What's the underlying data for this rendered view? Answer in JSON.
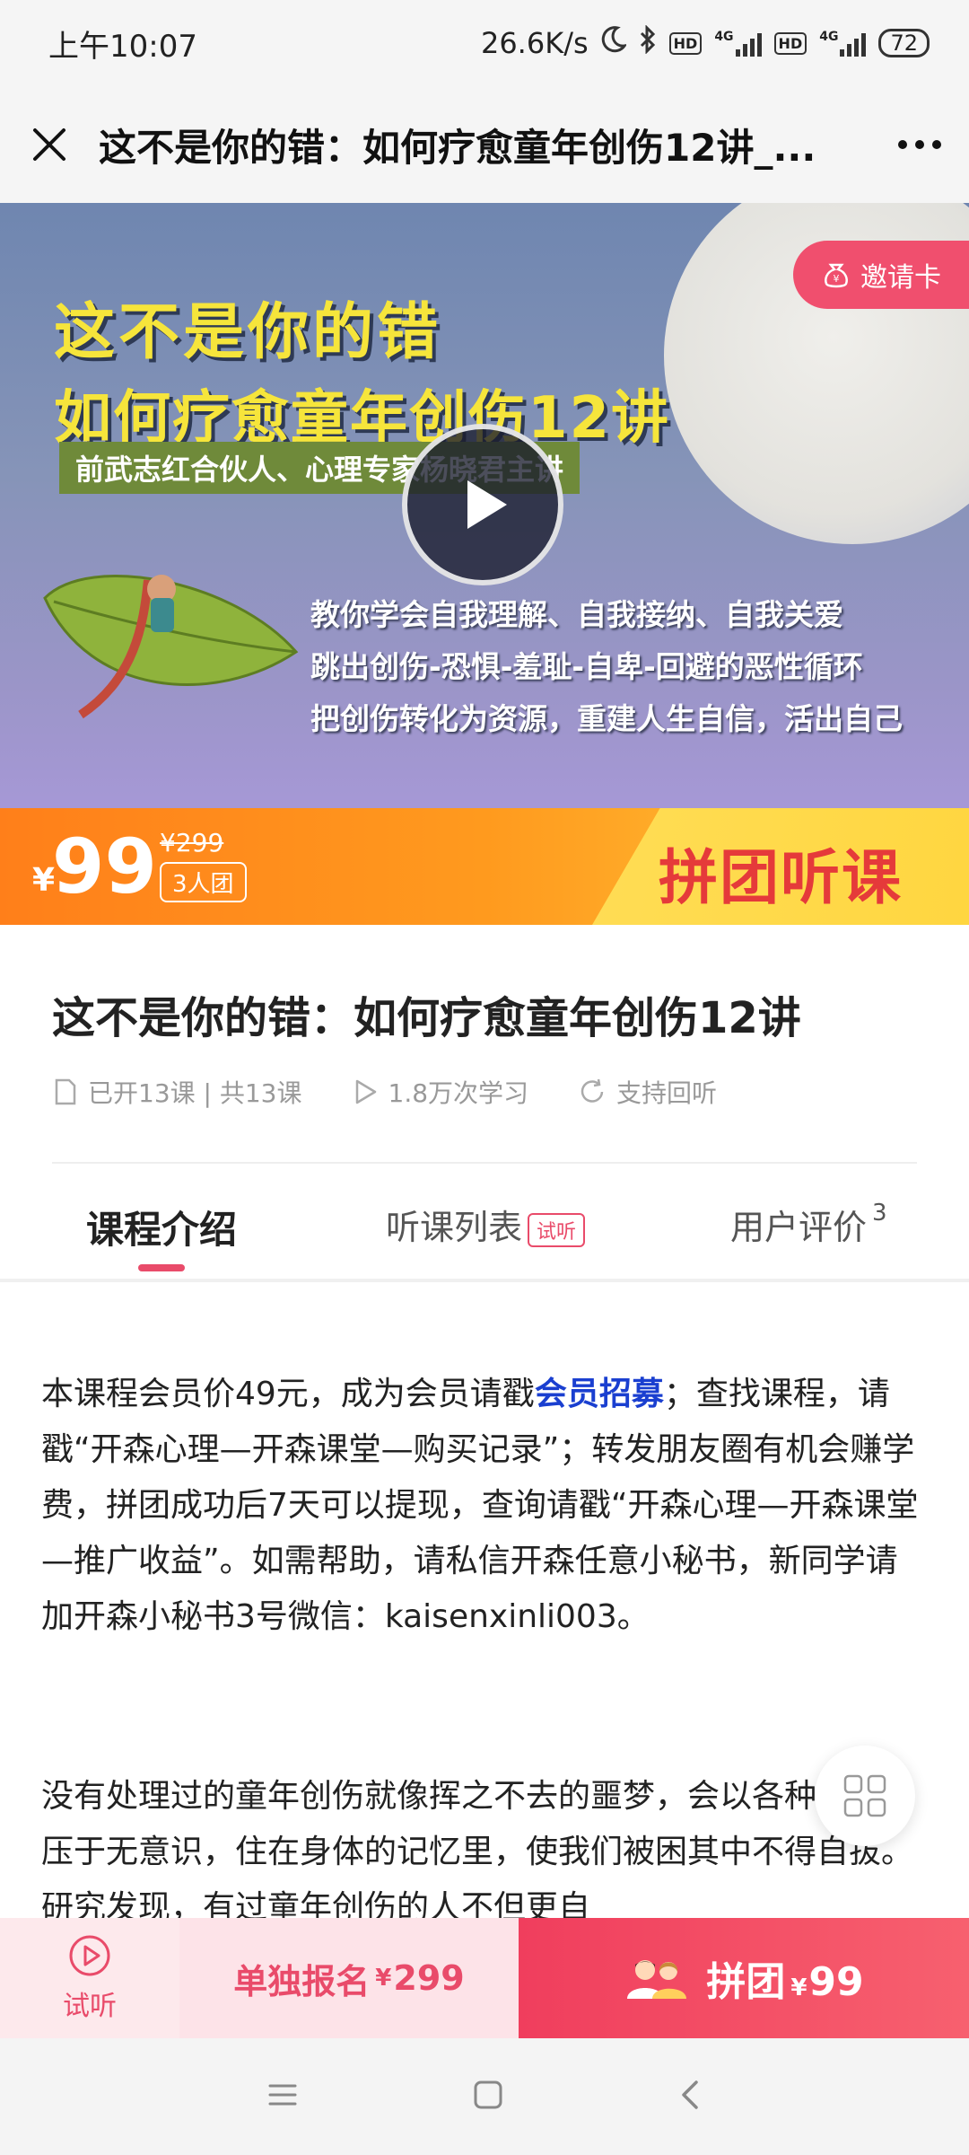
{
  "status_bar": {
    "time": "上午10:07",
    "net_speed": "26.6K/s",
    "net1": "4G",
    "net2": "4G",
    "hd": "HD",
    "battery": "72"
  },
  "title_bar": {
    "title": "这不是你的错：如何疗愈童年创伤12讲_..."
  },
  "banner": {
    "title_line1": "这不是你的错",
    "title_line2": "如何疗愈童年创伤12讲",
    "subtitle": "前武志红合伙人、心理专家杨晓君主讲",
    "lines": [
      "教你学会自我理解、自我接纳、自我关爱",
      "跳出创伤-恐惧-羞耻-自卑-回避的恶性循环",
      "把创伤转化为资源，重建人生自信，活出自己"
    ],
    "invite_label": "邀请卡"
  },
  "price_bar": {
    "currency": "¥",
    "price": "99",
    "original_price": "¥299",
    "group_tag": "3人团",
    "group_label": "拼团听课"
  },
  "course": {
    "title": "这不是你的错：如何疗愈童年创伤12讲",
    "lessons": "已开13课 | 共13课",
    "learners": "1.8万次学习",
    "replay": "支持回听"
  },
  "tabs": {
    "intro": "课程介绍",
    "list": "听课列表",
    "trial_badge": "试听",
    "review": "用户评价",
    "review_count": "3"
  },
  "description": {
    "p1_before_link": "本课程会员价49元，成为会员请戳",
    "p1_link": "会员招募",
    "p1_after_link": "；查找课程，请戳“开森心理—开森课堂—购买记录”；转发朋友圈有机会赚学费，拼团成功后7天可以提现，查询请戳“开森心理—开森课堂—推广收益”。如需帮助，请私信开森任意小秘书，新同学请加开森小秘书3号微信：kaisenxinli003。",
    "p2": "没有处理过的童年创伤就像挥之不去的噩梦，会以各种形式潜压于无意识，住在身体的记忆里，使我们被困其中不得自拔。研究发现，有过童年创伤的人不但更自"
  },
  "action_bar": {
    "trial": "试听",
    "single_label": "单独报名",
    "single_currency": "¥",
    "single_price": "299",
    "group_label": "拼团",
    "group_currency": "¥",
    "group_price": "99"
  },
  "colors": {
    "accent": "#e94b6a",
    "price_orange": "#ff8a1e",
    "link_blue": "#1a3fd0"
  }
}
